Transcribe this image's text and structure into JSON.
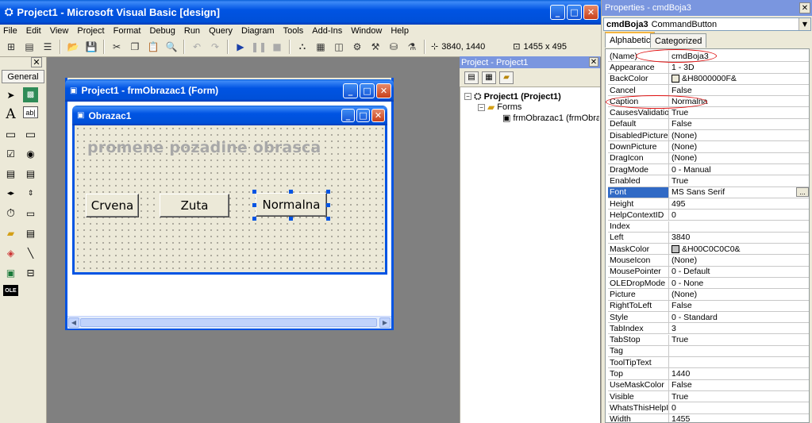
{
  "main_window": {
    "title": "Project1 - Microsoft Visual Basic [design]",
    "menu": [
      "File",
      "Edit",
      "View",
      "Project",
      "Format",
      "Debug",
      "Run",
      "Query",
      "Diagram",
      "Tools",
      "Add-Ins",
      "Window",
      "Help"
    ],
    "toolbar": {
      "position_readout": "3840, 1440",
      "size_readout": "1455 x 495"
    }
  },
  "toolbox": {
    "tab_label": "General",
    "tools": [
      "pointer-tool",
      "picturebox-tool",
      "label-tool",
      "textbox-tool",
      "frame-tool",
      "commandbutton-tool",
      "checkbox-tool",
      "optionbutton-tool",
      "combobox-tool",
      "listbox-tool",
      "hscrollbar-tool",
      "vscrollbar-tool",
      "timer-tool",
      "drivelistbox-tool",
      "dirlistbox-tool",
      "filelistbox-tool",
      "shape-tool",
      "line-tool",
      "image-tool",
      "data-tool",
      "ole-tool"
    ]
  },
  "form_window": {
    "title": "Project1 - frmObrazac1 (Form)"
  },
  "obrazac": {
    "title": "Obrazac1",
    "caption_label": "promene pozadine obrasca",
    "buttons": {
      "crvena": "Crvena",
      "zuta": "Zuta",
      "normalna": "Normalna"
    }
  },
  "project_explorer": {
    "title": "Project - Project1",
    "root": "Project1 (Project1)",
    "folder": "Forms",
    "form_item": "frmObrazac1 (frmObrazac1)"
  },
  "properties": {
    "title": "Properties - cmdBoja3",
    "object_name": "cmdBoja3",
    "object_type": "CommandButton",
    "tab_alphabetic": "Alphabetic",
    "tab_categorized": "Categorized",
    "selected_property": "Font",
    "highlight_color": "#e01010",
    "rows": [
      {
        "name": "(Name)",
        "value": "cmdBoja3"
      },
      {
        "name": "Appearance",
        "value": "1 - 3D"
      },
      {
        "name": "BackColor",
        "value": "&H8000000F&",
        "swatch": "#ece9d8"
      },
      {
        "name": "Cancel",
        "value": "False"
      },
      {
        "name": "Caption",
        "value": "Normalna"
      },
      {
        "name": "CausesValidation",
        "value": "True"
      },
      {
        "name": "Default",
        "value": "False"
      },
      {
        "name": "DisabledPicture",
        "value": "(None)"
      },
      {
        "name": "DownPicture",
        "value": "(None)"
      },
      {
        "name": "DragIcon",
        "value": "(None)"
      },
      {
        "name": "DragMode",
        "value": "0 - Manual"
      },
      {
        "name": "Enabled",
        "value": "True"
      },
      {
        "name": "Font",
        "value": "MS Sans Serif"
      },
      {
        "name": "Height",
        "value": "495"
      },
      {
        "name": "HelpContextID",
        "value": "0"
      },
      {
        "name": "Index",
        "value": ""
      },
      {
        "name": "Left",
        "value": "3840"
      },
      {
        "name": "MaskColor",
        "value": "&H00C0C0C0&",
        "swatch": "#c0c0c0"
      },
      {
        "name": "MouseIcon",
        "value": "(None)"
      },
      {
        "name": "MousePointer",
        "value": "0 - Default"
      },
      {
        "name": "OLEDropMode",
        "value": "0 - None"
      },
      {
        "name": "Picture",
        "value": "(None)"
      },
      {
        "name": "RightToLeft",
        "value": "False"
      },
      {
        "name": "Style",
        "value": "0 - Standard"
      },
      {
        "name": "TabIndex",
        "value": "3"
      },
      {
        "name": "TabStop",
        "value": "True"
      },
      {
        "name": "Tag",
        "value": ""
      },
      {
        "name": "ToolTipText",
        "value": ""
      },
      {
        "name": "Top",
        "value": "1440"
      },
      {
        "name": "UseMaskColor",
        "value": "False"
      },
      {
        "name": "Visible",
        "value": "True"
      },
      {
        "name": "WhatsThisHelpID",
        "value": "0"
      },
      {
        "name": "Width",
        "value": "1455"
      }
    ]
  }
}
